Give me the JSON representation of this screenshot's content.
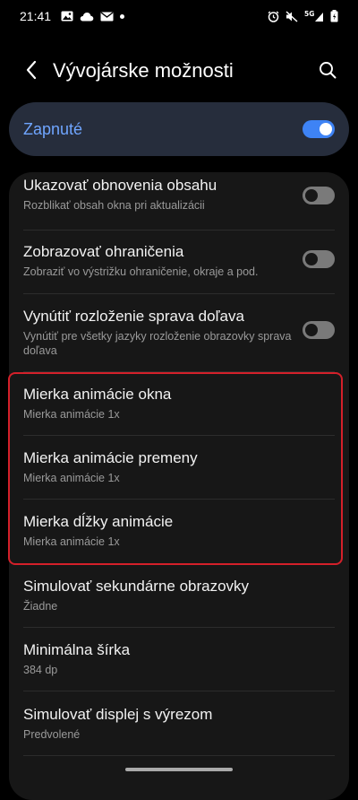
{
  "status_bar": {
    "time": "21:41",
    "left_icons": [
      "gallery-icon",
      "cloud-icon",
      "mail-icon",
      "notification-dot"
    ],
    "right_icons": [
      "alarm-icon",
      "mute-icon",
      "signal-5g-icon",
      "battery-icon"
    ],
    "network_label": "5G"
  },
  "header": {
    "title": "Vývojárske možnosti",
    "back_icon": "chevron-left-icon",
    "search_icon": "search-icon"
  },
  "master": {
    "label": "Zapnuté",
    "enabled": true
  },
  "settings": [
    {
      "title": "Ukazovať obnovenia obsahu",
      "subtitle": "Rozblikať obsah okna pri aktualizácii",
      "toggle": true,
      "on": false
    },
    {
      "title": "Zobrazovať ohraničenia",
      "subtitle": "Zobraziť vo výstrižku ohraničenie, okraje a pod.",
      "toggle": true,
      "on": false
    },
    {
      "title": "Vynútiť rozloženie sprava doľava",
      "subtitle": "Vynútiť pre všetky jazyky rozloženie obrazovky sprava doľava",
      "toggle": true,
      "on": false
    },
    {
      "title": "Mierka animácie okna",
      "subtitle": "Mierka animácie 1x",
      "toggle": false
    },
    {
      "title": "Mierka animácie premeny",
      "subtitle": "Mierka animácie 1x",
      "toggle": false
    },
    {
      "title": "Mierka dĺžky animácie",
      "subtitle": "Mierka animácie 1x",
      "toggle": false
    },
    {
      "title": "Simulovať sekundárne obrazovky",
      "subtitle": "Žiadne",
      "toggle": false
    },
    {
      "title": "Minimálna šírka",
      "subtitle": "384 dp",
      "toggle": false
    },
    {
      "title": "Simulovať displej s výrezom",
      "subtitle": "Predvolené",
      "toggle": false
    }
  ],
  "colors": {
    "accent": "#3e83f5",
    "accent_text": "#6fa5ff",
    "highlight": "#d4202a",
    "card_bg": "#171717",
    "master_bg": "#262d3c"
  }
}
